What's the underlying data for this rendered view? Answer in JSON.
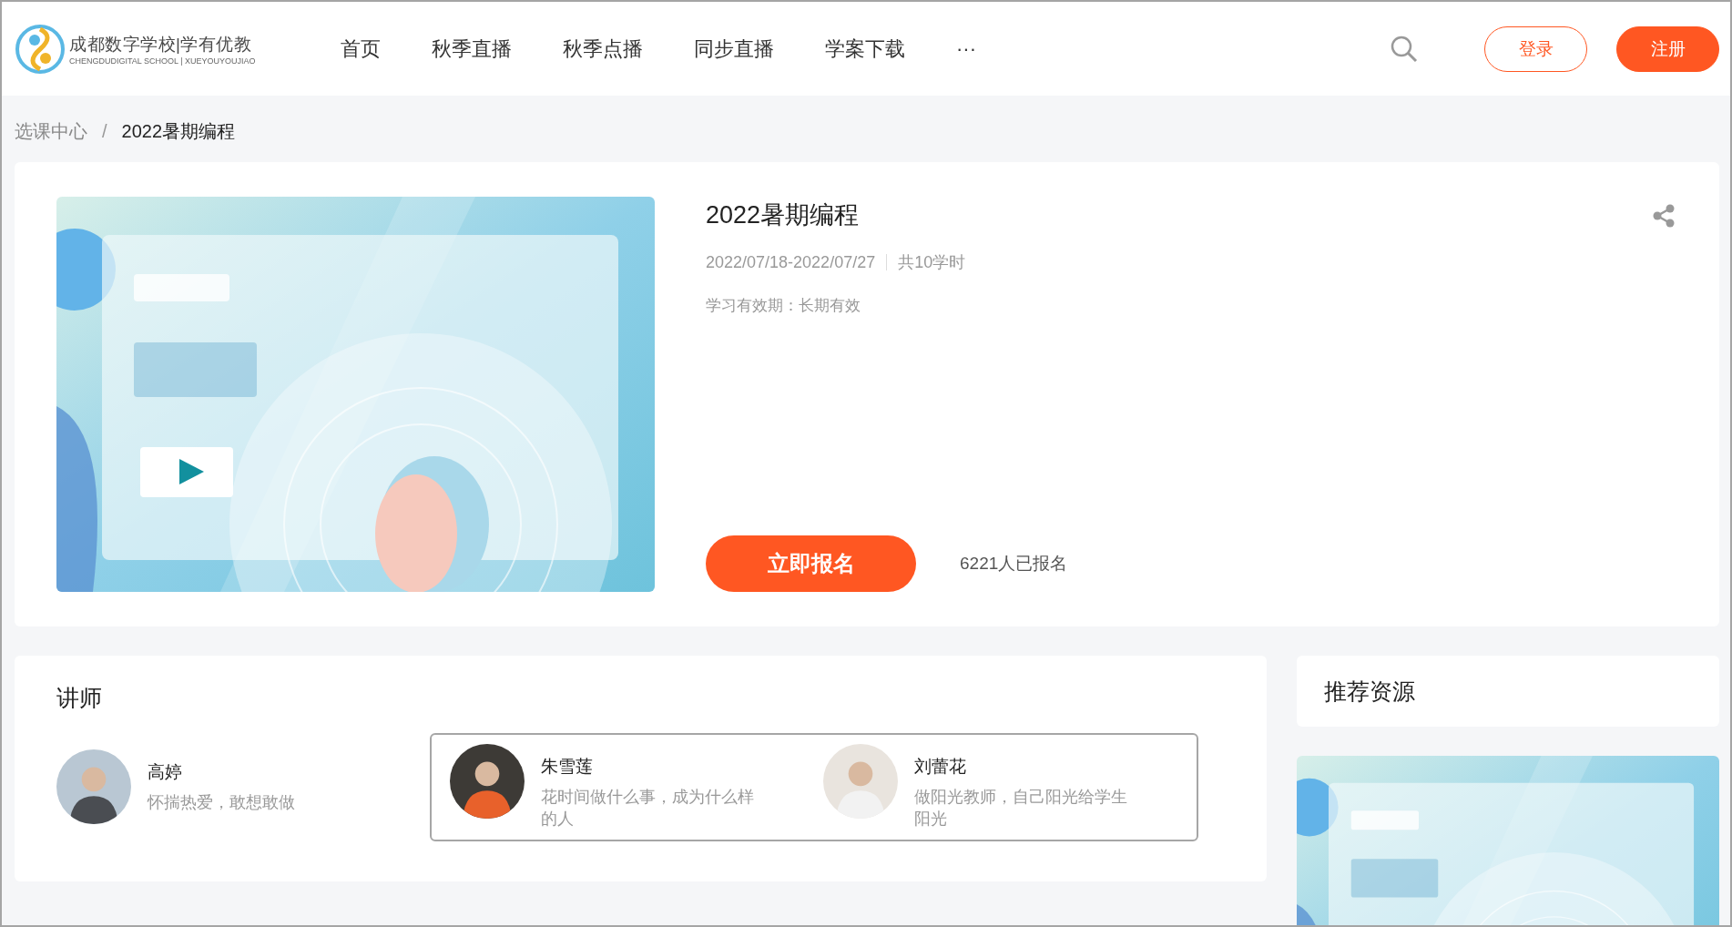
{
  "header": {
    "logo": {
      "title": "成都数字学校|学有优教",
      "subtitle": "CHENGDUDIGITAL SCHOOL | XUEYOUYOUJIAO"
    },
    "nav": [
      {
        "label": "首页"
      },
      {
        "label": "秋季直播"
      },
      {
        "label": "秋季点播"
      },
      {
        "label": "同步直播"
      },
      {
        "label": "学案下载"
      },
      {
        "label": "···"
      }
    ],
    "buttons": [
      {
        "label": "登录",
        "kind": "outline"
      },
      {
        "label": "注册",
        "kind": "filled"
      }
    ]
  },
  "breadcrumb": {
    "separator": "/",
    "items": [
      {
        "label": "选课中心",
        "current": false
      },
      {
        "label": "2022暑期编程",
        "current": true
      }
    ]
  },
  "course": {
    "title": "2022暑期编程",
    "dates": "2022/07/18-2022/07/27",
    "hours": "共10学时",
    "validity": "学习有效期：长期有效",
    "enroll_button": "立即报名",
    "enrolled": "6221人已报名"
  },
  "lecturers": {
    "title": "讲师",
    "items": [
      {
        "name": "高婷",
        "motto": "怀揣热爱，敢想敢做",
        "framed": false
      },
      {
        "name": "朱雪莲",
        "motto": "花时间做什么事，成为什么样的人",
        "framed": true
      },
      {
        "name": "刘蕾花",
        "motto": "做阳光教师，自己阳光给学生阳光",
        "framed": true
      }
    ]
  },
  "recommended": {
    "title": "推荐资源"
  }
}
